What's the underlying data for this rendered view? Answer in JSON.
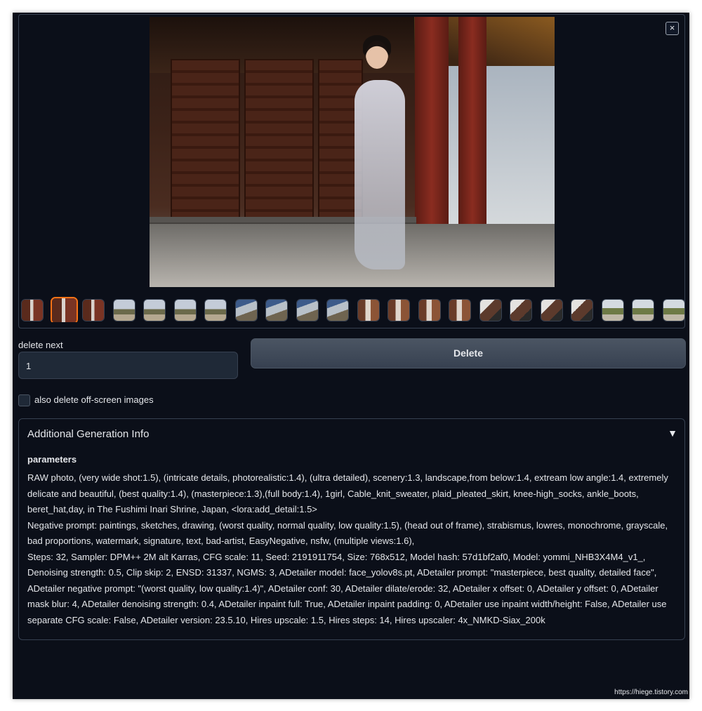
{
  "gallery": {
    "close_label": "×",
    "thumbnails": [
      {
        "style": "a"
      },
      {
        "style": "a",
        "selected": true
      },
      {
        "style": "a"
      },
      {
        "style": "b"
      },
      {
        "style": "b"
      },
      {
        "style": "b"
      },
      {
        "style": "b"
      },
      {
        "style": "c"
      },
      {
        "style": "c"
      },
      {
        "style": "c"
      },
      {
        "style": "c"
      },
      {
        "style": "d"
      },
      {
        "style": "d"
      },
      {
        "style": "d"
      },
      {
        "style": "d"
      },
      {
        "style": "e"
      },
      {
        "style": "e"
      },
      {
        "style": "e"
      },
      {
        "style": "e"
      },
      {
        "style": "f"
      },
      {
        "style": "f"
      },
      {
        "style": "f"
      }
    ]
  },
  "controls": {
    "delete_next_label": "delete next",
    "delete_next_value": "1",
    "delete_button_label": "Delete",
    "offscreen_checkbox_label": "also delete off-screen images",
    "offscreen_checked": false
  },
  "generation_info": {
    "title": "Additional Generation Info",
    "toggle_icon": "▼",
    "parameters_heading": "parameters",
    "prompt": "RAW photo, (very wide shot:1.5), (intricate details, photorealistic:1.4), (ultra detailed), scenery:1.3, landscape,from below:1.4, extream low angle:1.4, extremely delicate and beautiful, (best quality:1.4), (masterpiece:1.3),(full body:1.4), 1girl, Cable_knit_sweater, plaid_pleated_skirt, knee-high_socks, ankle_boots, beret_hat,day, in The Fushimi Inari Shrine, Japan, <lora:add_detail:1.5>",
    "negative_prompt": "Negative prompt: paintings, sketches, drawing, (worst quality, normal quality, low quality:1.5), (head out of frame), strabismus, lowres, monochrome, grayscale, bad proportions, watermark, signature, text, bad-artist, EasyNegative, nsfw, (multiple views:1.6),",
    "settings": "Steps: 32, Sampler: DPM++ 2M alt Karras, CFG scale: 11, Seed: 2191911754, Size: 768x512, Model hash: 57d1bf2af0, Model: yommi_NHB3X4M4_v1_, Denoising strength: 0.5, Clip skip: 2, ENSD: 31337, NGMS: 3, ADetailer model: face_yolov8s.pt, ADetailer prompt: \"masterpiece, best quality, detailed face\", ADetailer negative prompt: \"(worst quality, low quality:1.4)\", ADetailer conf: 30, ADetailer dilate/erode: 32, ADetailer x offset: 0, ADetailer y offset: 0, ADetailer mask blur: 4, ADetailer denoising strength: 0.4, ADetailer inpaint full: True, ADetailer inpaint padding: 0, ADetailer use inpaint width/height: False, ADetailer use separate CFG scale: False, ADetailer version: 23.5.10, Hires upscale: 1.5, Hires steps: 14, Hires upscaler: 4x_NMKD-Siax_200k"
  },
  "watermark": "https://hiege.tistory.com"
}
